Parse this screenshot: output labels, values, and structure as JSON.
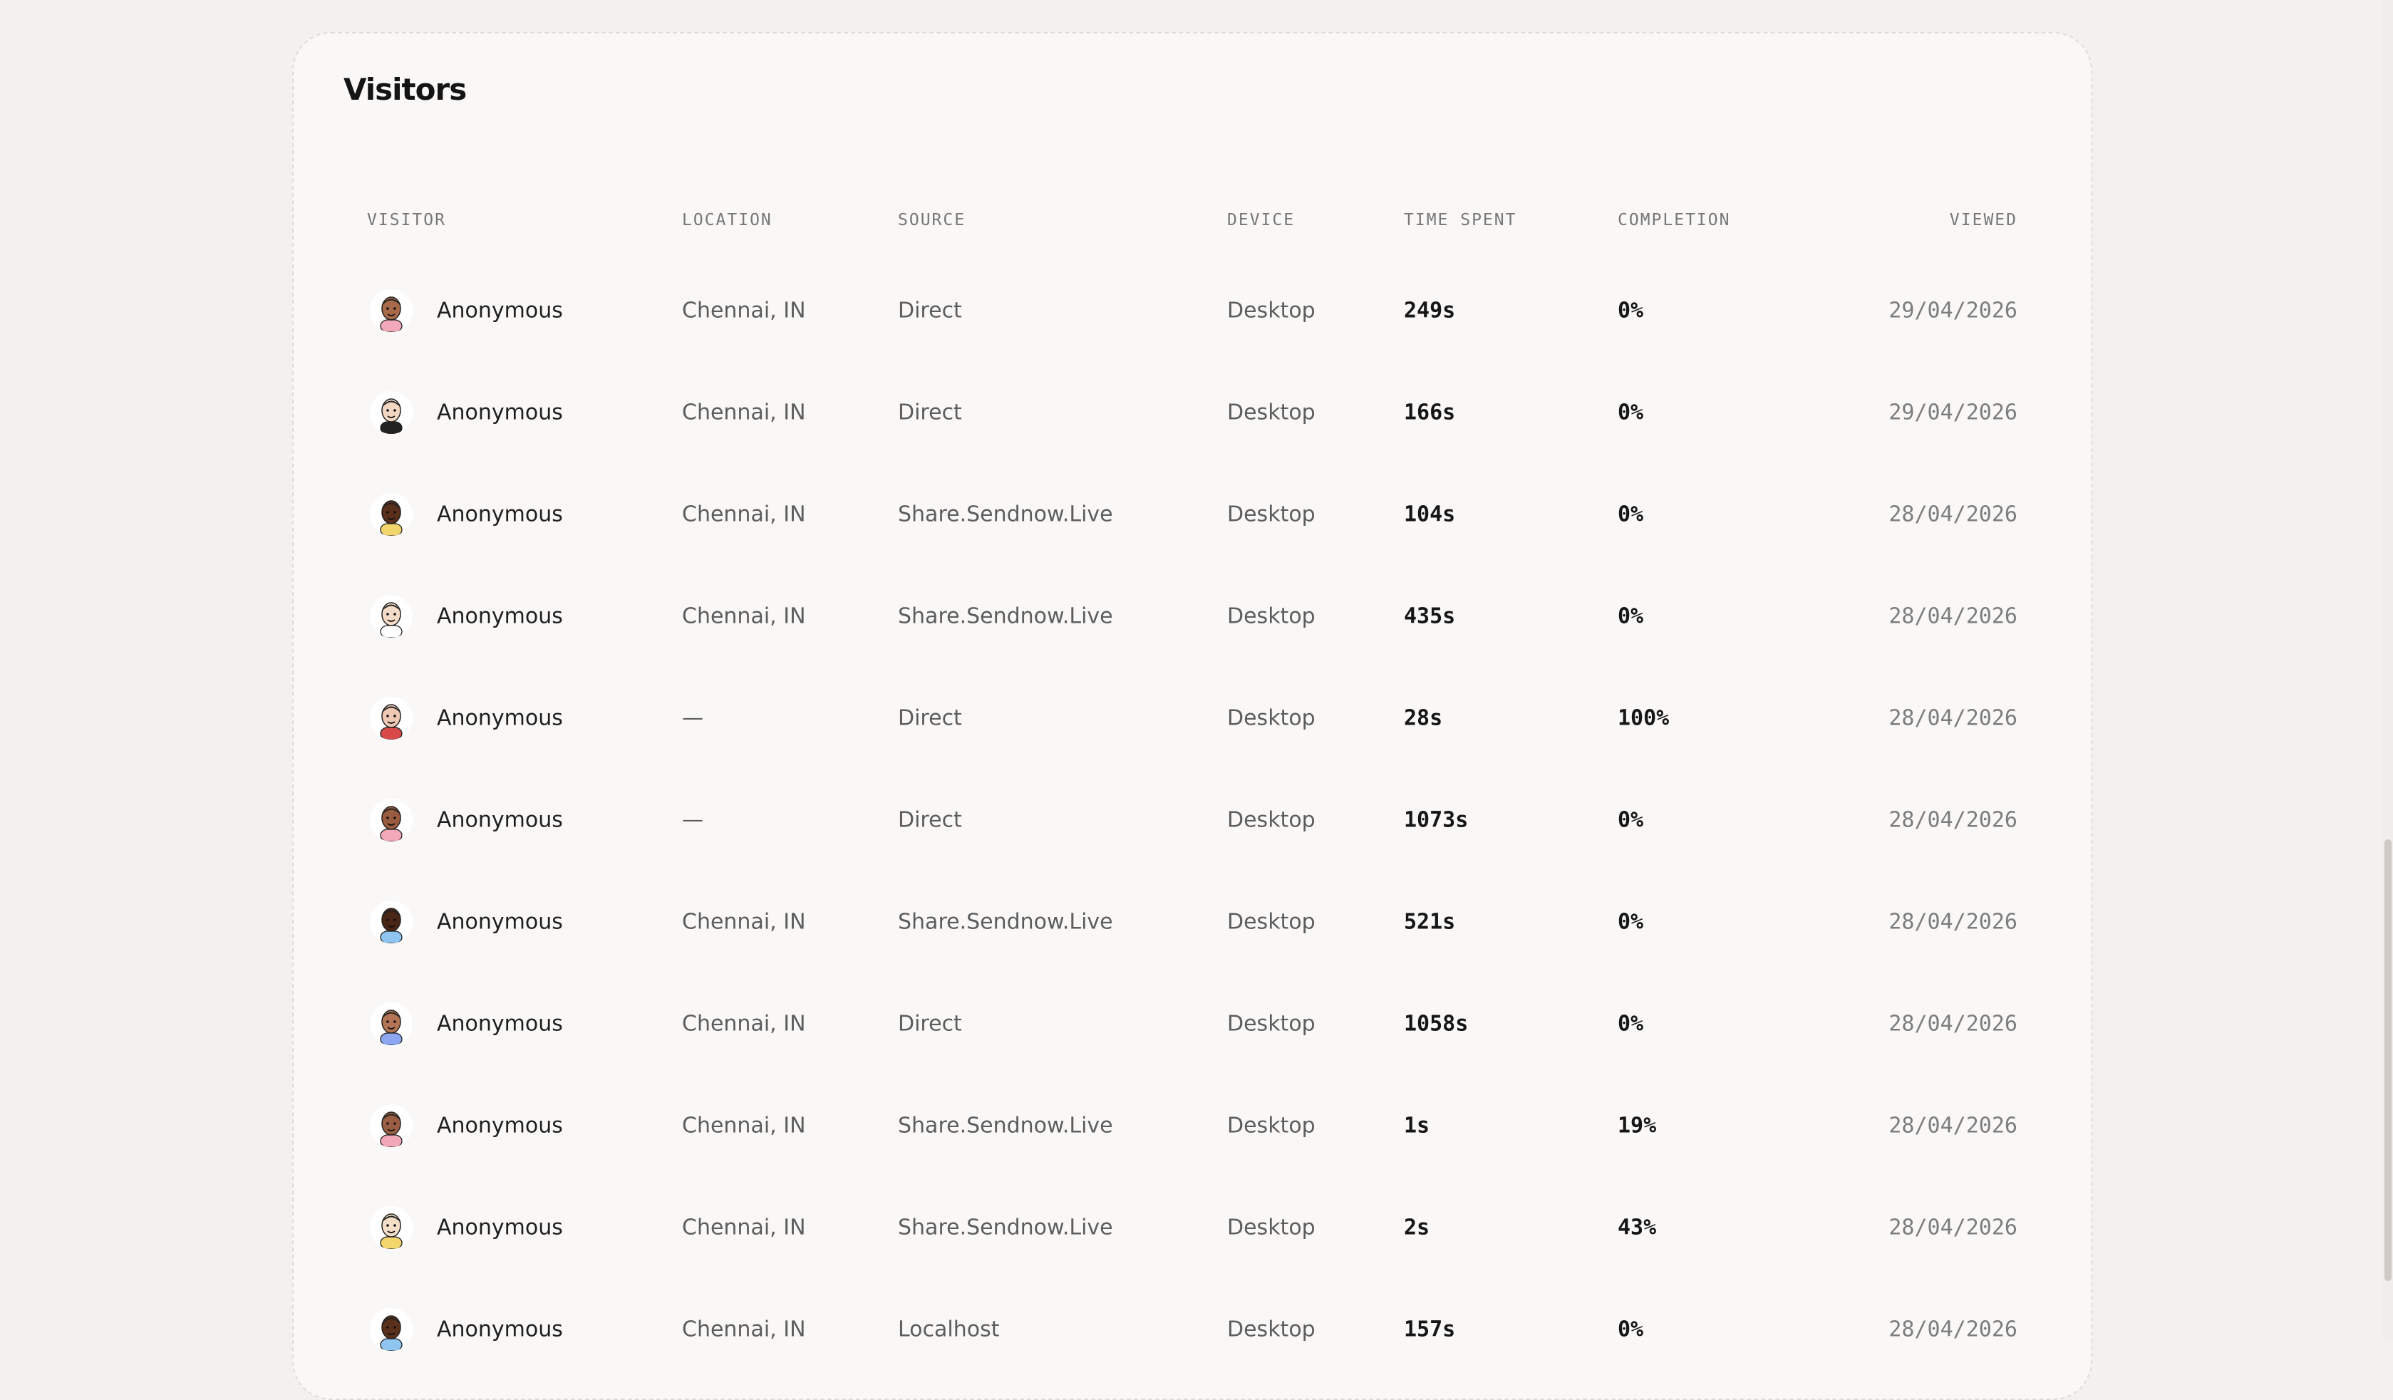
{
  "visitors": {
    "title": "Visitors",
    "columns": {
      "visitor": "VISITOR",
      "location": "LOCATION",
      "source": "SOURCE",
      "device": "DEVICE",
      "time_spent": "TIME SPENT",
      "completion": "COMPLETION",
      "viewed": "VIEWED"
    },
    "rows": [
      {
        "visitor": "Anonymous",
        "location": "Chennai, IN",
        "source": "Direct",
        "device": "Desktop",
        "time_spent": "249s",
        "completion": "0%",
        "viewed": "29/04/2026",
        "avatar": {
          "skin": "#a86a4a",
          "hair": "#3a2418",
          "shirt": "#f2a8b8"
        }
      },
      {
        "visitor": "Anonymous",
        "location": "Chennai, IN",
        "source": "Direct",
        "device": "Desktop",
        "time_spent": "166s",
        "completion": "0%",
        "viewed": "29/04/2026",
        "avatar": {
          "skin": "#f2d7c2",
          "hair": "#8a5a3c",
          "shirt": "#222222"
        }
      },
      {
        "visitor": "Anonymous",
        "location": "Chennai, IN",
        "source": "Share.Sendnow.Live",
        "device": "Desktop",
        "time_spent": "104s",
        "completion": "0%",
        "viewed": "28/04/2026",
        "avatar": {
          "skin": "#5a2f1c",
          "hair": "#1b0f09",
          "shirt": "#f3d66b"
        }
      },
      {
        "visitor": "Anonymous",
        "location": "Chennai, IN",
        "source": "Share.Sendnow.Live",
        "device": "Desktop",
        "time_spent": "435s",
        "completion": "0%",
        "viewed": "28/04/2026",
        "avatar": {
          "skin": "#f4dcc8",
          "hair": "#6a4330",
          "shirt": "#ffffff"
        }
      },
      {
        "visitor": "Anonymous",
        "location": "—",
        "source": "Direct",
        "device": "Desktop",
        "time_spent": "28s",
        "completion": "100%",
        "viewed": "28/04/2026",
        "avatar": {
          "skin": "#efc8b4",
          "hair": "#e98aa6",
          "shirt": "#d84a4a"
        }
      },
      {
        "visitor": "Anonymous",
        "location": "—",
        "source": "Direct",
        "device": "Desktop",
        "time_spent": "1073s",
        "completion": "0%",
        "viewed": "28/04/2026",
        "avatar": {
          "skin": "#9a5c40",
          "hair": "#ffffff",
          "shirt": "#f2a8b8"
        }
      },
      {
        "visitor": "Anonymous",
        "location": "Chennai, IN",
        "source": "Share.Sendnow.Live",
        "device": "Desktop",
        "time_spent": "521s",
        "completion": "0%",
        "viewed": "28/04/2026",
        "avatar": {
          "skin": "#4a2616",
          "hair": "#140b07",
          "shirt": "#8fc5f0"
        }
      },
      {
        "visitor": "Anonymous",
        "location": "Chennai, IN",
        "source": "Direct",
        "device": "Desktop",
        "time_spent": "1058s",
        "completion": "0%",
        "viewed": "28/04/2026",
        "avatar": {
          "skin": "#b57456",
          "hair": "#e98aa6",
          "shirt": "#8da6f2"
        }
      },
      {
        "visitor": "Anonymous",
        "location": "Chennai, IN",
        "source": "Share.Sendnow.Live",
        "device": "Desktop",
        "time_spent": "1s",
        "completion": "19%",
        "viewed": "28/04/2026",
        "avatar": {
          "skin": "#9b5e44",
          "hair": "#2a1810",
          "shirt": "#f2a8b8"
        }
      },
      {
        "visitor": "Anonymous",
        "location": "Chennai, IN",
        "source": "Share.Sendnow.Live",
        "device": "Desktop",
        "time_spent": "2s",
        "completion": "43%",
        "viewed": "28/04/2026",
        "avatar": {
          "skin": "#f5dfc8",
          "hair": "#efe2d2",
          "shirt": "#f3d66b"
        }
      },
      {
        "visitor": "Anonymous",
        "location": "Chennai, IN",
        "source": "Localhost",
        "device": "Desktop",
        "time_spent": "157s",
        "completion": "0%",
        "viewed": "28/04/2026",
        "avatar": {
          "skin": "#5a2f1c",
          "hair": "#f0c23a",
          "shirt": "#8fc5f0"
        }
      }
    ]
  }
}
